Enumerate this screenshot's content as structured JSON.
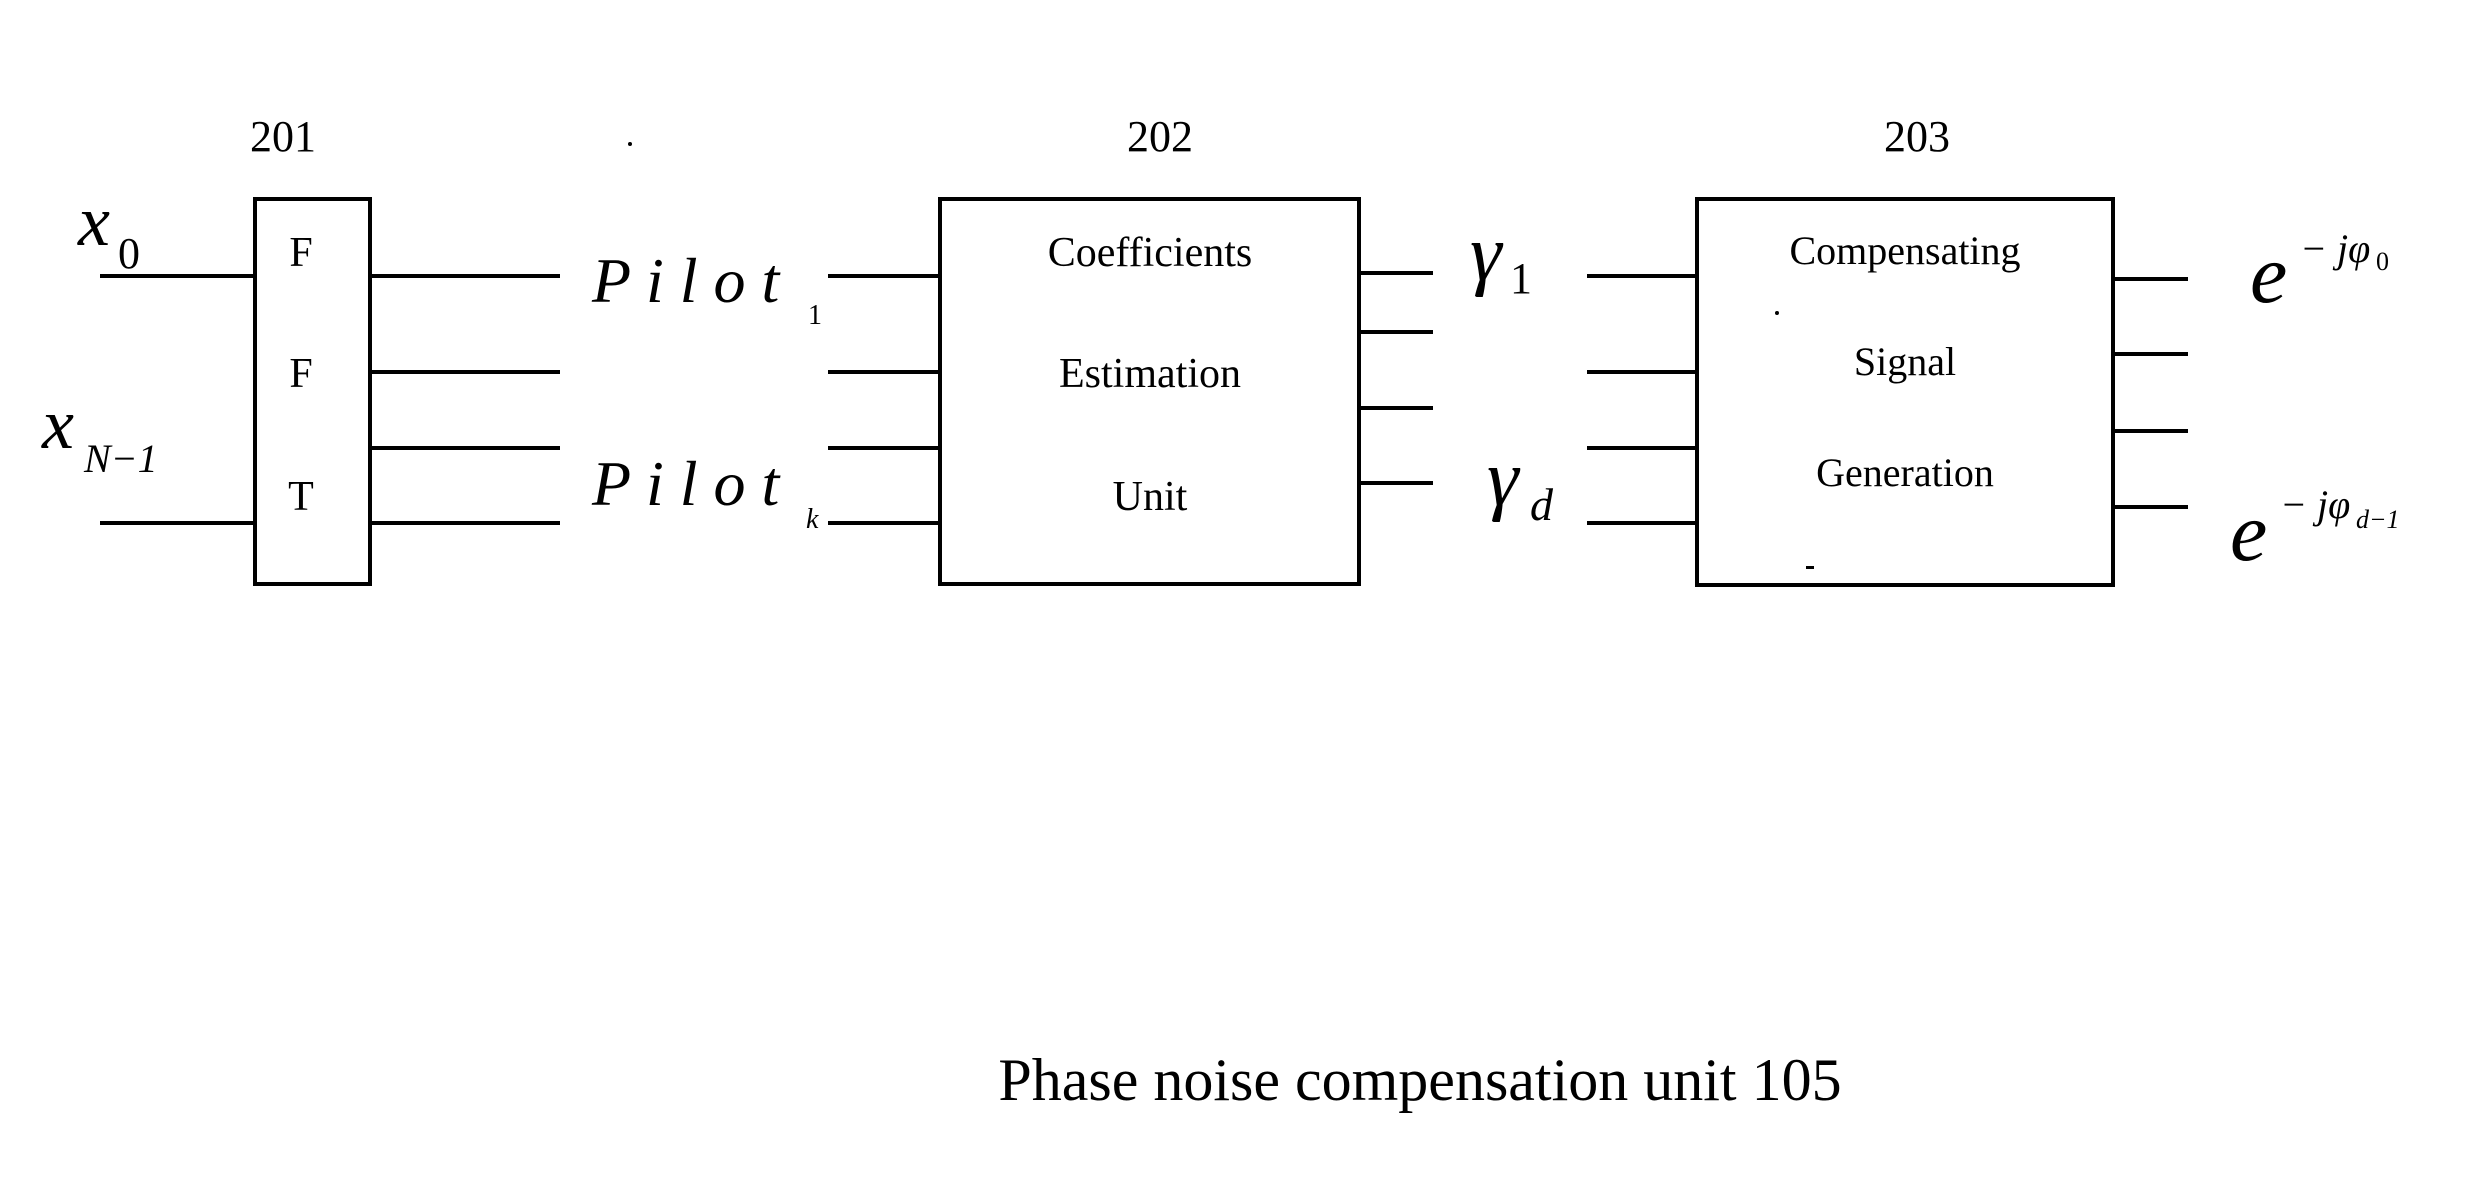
{
  "diagram": {
    "caption": "Phase noise compensation unit 105",
    "blocks": [
      {
        "id": "201",
        "label_lines": [
          "F",
          "F",
          "T"
        ]
      },
      {
        "id": "202",
        "label_lines": [
          "Coefficients",
          "Estimation",
          "Unit"
        ]
      },
      {
        "id": "203",
        "label_lines": [
          "Compensating",
          "Signal",
          "Generation"
        ]
      }
    ],
    "inputs": {
      "first": {
        "base": "x",
        "sub": "0"
      },
      "last": {
        "base": "x",
        "sub": "N−1"
      }
    },
    "pilots": {
      "first": {
        "base": "P i l o t",
        "sub": "1"
      },
      "last": {
        "base": "P i l o t",
        "sub": "k"
      }
    },
    "coefficients": {
      "first": {
        "base": "γ",
        "sub": "1"
      },
      "last": {
        "base": "γ",
        "sub": "d"
      }
    },
    "outputs": {
      "first": {
        "base": "e",
        "sup": "− jφ",
        "sup_sub": "0"
      },
      "last": {
        "base": "e",
        "sup": "− jφ",
        "sup_sub": "d−1"
      }
    }
  }
}
